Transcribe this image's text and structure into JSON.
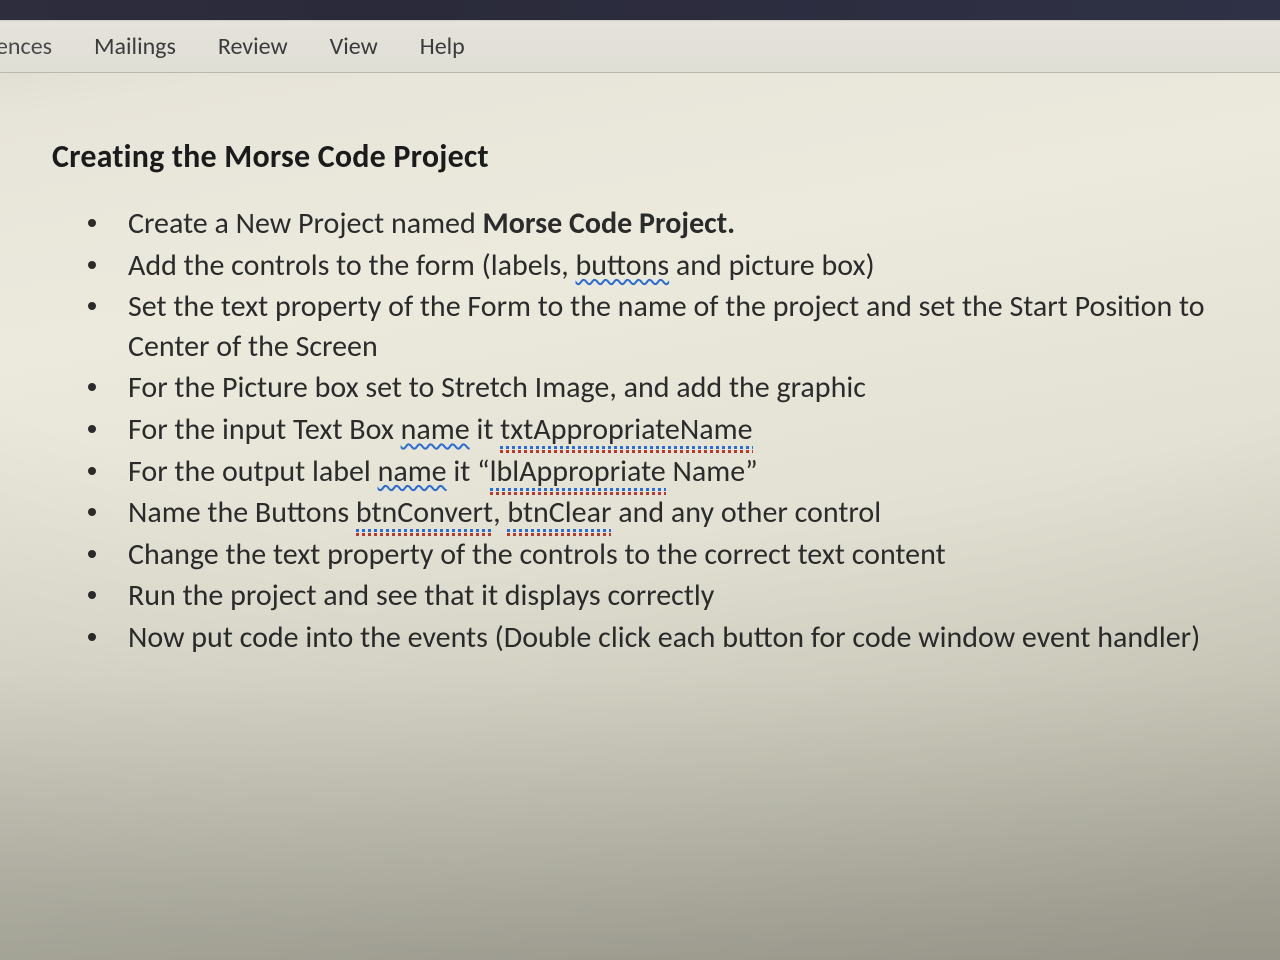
{
  "ribbon": {
    "tabs": [
      "erences",
      "Mailings",
      "Review",
      "View",
      "Help"
    ]
  },
  "heading": "Creating the Morse Code Project",
  "bullets": {
    "b1_pre": "Create a New Project named ",
    "b1_bold": "Morse Code Project.",
    "b2_pre": "Add the controls to the form (labels, ",
    "b2_u": "buttons",
    "b2_post": " and picture box)",
    "b3": "Set the text property of the Form to the name of the project and set the Start Position to Center of the Screen",
    "b4": "For the Picture box set to Stretch Image, and add the graphic",
    "b5_pre": "For the input Text Box ",
    "b5_name": "name",
    "b5_mid": " it ",
    "b5_code": "txtAppropriateName",
    "b6_pre": "For the output label ",
    "b6_name": "name",
    "b6_mid": " it “",
    "b6_code": "lblAppropriate",
    "b6_post": " Name”",
    "b7_pre": "Name the Buttons ",
    "b7_a": "btnConvert",
    "b7_comma": ", ",
    "b7_b": "btnClear",
    "b7_post": " and any other control",
    "b8": "Change the text property of the controls to the correct text content",
    "b9": "Run the project and see that it displays correctly",
    "b10": "Now put code into the events (Double click each button for code window event handler)"
  }
}
